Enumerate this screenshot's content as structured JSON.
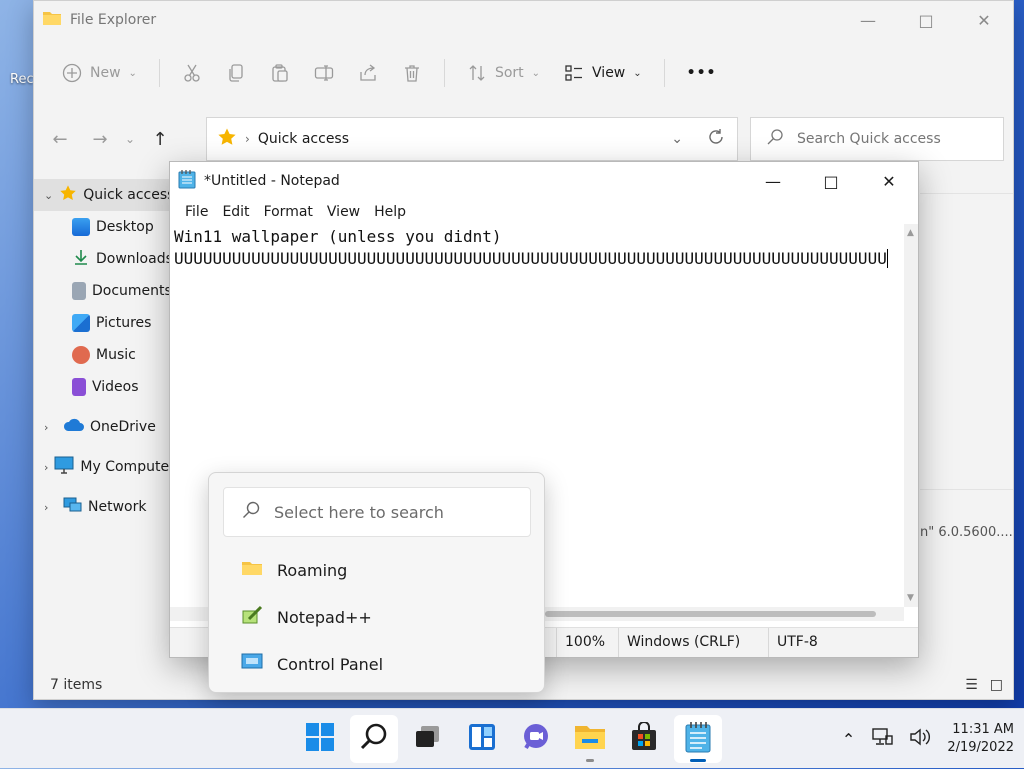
{
  "desktop": {
    "label": "Rec"
  },
  "explorer": {
    "title": "File Explorer",
    "toolbar": {
      "new_label": "New",
      "sort_label": "Sort",
      "view_label": "View",
      "more_label": "•••"
    },
    "address": {
      "path": "Quick access"
    },
    "search": {
      "placeholder": "Search Quick access"
    },
    "nav": [
      {
        "label": "Quick access",
        "icon": "star-icon"
      },
      {
        "label": "Desktop",
        "icon": "desktop-icon"
      },
      {
        "label": "Downloads",
        "icon": "download-icon"
      },
      {
        "label": "Documents",
        "icon": "document-icon"
      },
      {
        "label": "Pictures",
        "icon": "pictures-icon"
      },
      {
        "label": "Music",
        "icon": "music-icon"
      },
      {
        "label": "Videos",
        "icon": "videos-icon"
      },
      {
        "label": "OneDrive",
        "icon": "cloud-icon"
      },
      {
        "label": "My Computer",
        "icon": "computer-icon"
      },
      {
        "label": "Network",
        "icon": "network-icon"
      }
    ],
    "right_text": "n\" 6.0.5600....",
    "status": "7 items"
  },
  "notepad": {
    "title": "*Untitled - Notepad",
    "menu": [
      "File",
      "Edit",
      "Format",
      "View",
      "Help"
    ],
    "content_line1": "Win11 wallpaper (unless you didnt)",
    "content_line2": "UUUUUUUUUUUUUUUUUUUUUUUUUUUUUUUUUUUUUUUUUUUUUUUUUUUUUUUUUUUUUUUUUUUUUUUUUU",
    "status": {
      "zoom": "100%",
      "line_ending": "Windows (CRLF)",
      "encoding": "UTF-8"
    }
  },
  "search_flyout": {
    "placeholder": "Select here to search",
    "items": [
      {
        "label": "Roaming",
        "icon": "folder-icon"
      },
      {
        "label": "Notepad++",
        "icon": "notepadpp-icon"
      },
      {
        "label": "Control Panel",
        "icon": "control-panel-icon"
      }
    ]
  },
  "taskbar": {
    "apps": [
      "start-icon",
      "search-icon",
      "task-view-icon",
      "widgets-icon",
      "chat-icon",
      "file-explorer-icon",
      "store-icon",
      "notepad-icon"
    ],
    "clock_time": "11:31 AM",
    "clock_date": "2/19/2022"
  },
  "colors": {
    "accent": "#005fb8",
    "folder": "#f6c445",
    "star": "#f7b500"
  }
}
